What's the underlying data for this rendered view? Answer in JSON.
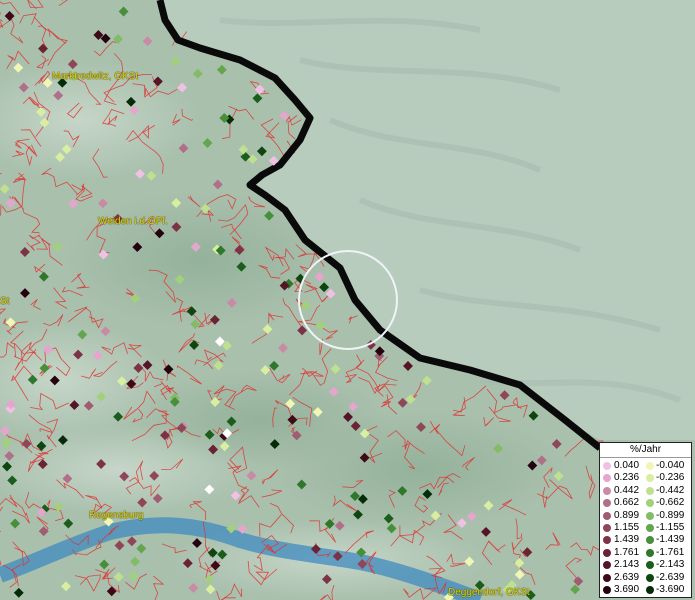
{
  "map": {
    "places": [
      {
        "name": "Marktredwitz, GKSt"
      },
      {
        "name": "Weiden i.d.OPf."
      },
      {
        "name": "Regensburg"
      },
      {
        "name": "Deggendorf, GKSt"
      },
      {
        "name": "St"
      }
    ],
    "legend": {
      "title": "%/Jahr",
      "positive": [
        {
          "value": "0.040",
          "color": "#f2c0e4"
        },
        {
          "value": "0.236",
          "color": "#e4a6cc"
        },
        {
          "value": "0.442",
          "color": "#c98aa6"
        },
        {
          "value": "0.662",
          "color": "#b0708a"
        },
        {
          "value": "0.899",
          "color": "#a05c72"
        },
        {
          "value": "1.155",
          "color": "#8f4658"
        },
        {
          "value": "1.439",
          "color": "#7d3346"
        },
        {
          "value": "1.761",
          "color": "#6b2334"
        },
        {
          "value": "2.143",
          "color": "#561526"
        },
        {
          "value": "2.639",
          "color": "#3e0a18"
        },
        {
          "value": "3.690",
          "color": "#240210"
        }
      ],
      "negative": [
        {
          "value": "-0.040",
          "color": "#f0f7b4"
        },
        {
          "value": "-0.236",
          "color": "#d8eea0"
        },
        {
          "value": "-0.442",
          "color": "#bfe08e"
        },
        {
          "value": "-0.662",
          "color": "#a2d07c"
        },
        {
          "value": "-0.899",
          "color": "#82bc66"
        },
        {
          "value": "-1.155",
          "color": "#63a64e"
        },
        {
          "value": "-1.439",
          "color": "#478f3a"
        },
        {
          "value": "-1.761",
          "color": "#2f772a"
        },
        {
          "value": "-2.143",
          "color": "#1b5e1c"
        },
        {
          "value": "-2.639",
          "color": "#0e4610"
        },
        {
          "value": "-3.690",
          "color": "#052c08"
        }
      ]
    },
    "colors": {
      "boundary": "#e03030",
      "border": "#0a0a0a",
      "river": "#3f8bbf",
      "terrain_west": "#a9c0ad",
      "terrain_east": "#b8ccbd",
      "label": "#e1d20a",
      "no_data_point": "#ffffff"
    },
    "marker_count": 220
  }
}
